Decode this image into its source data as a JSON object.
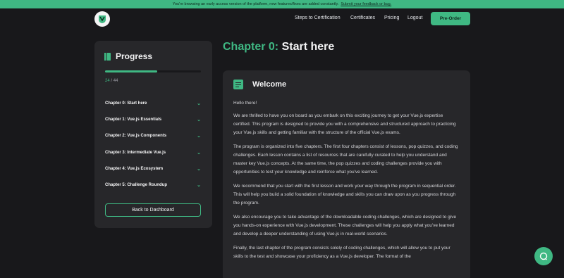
{
  "banner": {
    "text": "You're browsing an early access version of the platform, new features/fixes are added constantly.",
    "link": "Submit your feedback or bug."
  },
  "nav": {
    "links": [
      "Steps to Certification",
      "Certificates",
      "Pricing",
      "Logout"
    ],
    "cta": "Pre-Order"
  },
  "sidebar": {
    "title": "Progress",
    "progress": {
      "done": "24",
      "separator": " / ",
      "total": "44",
      "fraction": 0.545
    },
    "chapters": [
      "Chapter 0: Start here",
      "Chapter 1: Vue.js Essentials",
      "Chapter 2: Vue.js Components",
      "Chapter 3: Intermediate Vue.js",
      "Chapter 4: Vue.js Ecosystem",
      "Chapter 5: Challenge Roundup"
    ],
    "back_button": "Back to Dashboard"
  },
  "main": {
    "chapter_label": "Chapter 0:",
    "chapter_name": "Start here",
    "card": {
      "title": "Welcome",
      "paragraphs": [
        "Hello there!",
        "We are thrilled to have you on board as you embark on this exciting journey to get your Vue.js expertise certified. This program is designed to provide you with a comprehensive and structured approach to practicing your Vue.js skills and getting familiar with the structure of the official Vue.js exams.",
        "The program is organized into five chapters. The first four chapters consist of lessons, pop quizzes, and coding challenges. Each lesson contains a list of resources that are carefully curated to help you understand and master key Vue.js concepts. At the same time, the pop quizzes and coding challenges provide you with opportunities to test your knowledge and reinforce what you've learned.",
        "We recommend that you start with the first lesson and work your way through the program in sequential order. This will help you build a solid foundation of knowledge and skills you can draw upon as you progress through the program.",
        "We also encourage you to take advantage of the downloadable coding challenges, which are designed to give you hands-on experience with Vue.js development. These challenges will help you apply what you've learned and develop a deeper understanding of using Vue.js in real-world scenarios.",
        "Finally, the last chapter of the program consists solely of coding challenges, which will allow you to put your skills to the test and showcase your proficiency as a Vue.js developer. The format of the"
      ]
    }
  },
  "icons": {
    "logo": "vue-shield-logo-icon",
    "progress": "book-icon",
    "chevron": "chevron-down-icon",
    "card": "document-icon",
    "chat": "chat-bubble-icon"
  },
  "colors": {
    "accent": "#3fb883",
    "background": "#18181b",
    "panel": "#27272a"
  }
}
